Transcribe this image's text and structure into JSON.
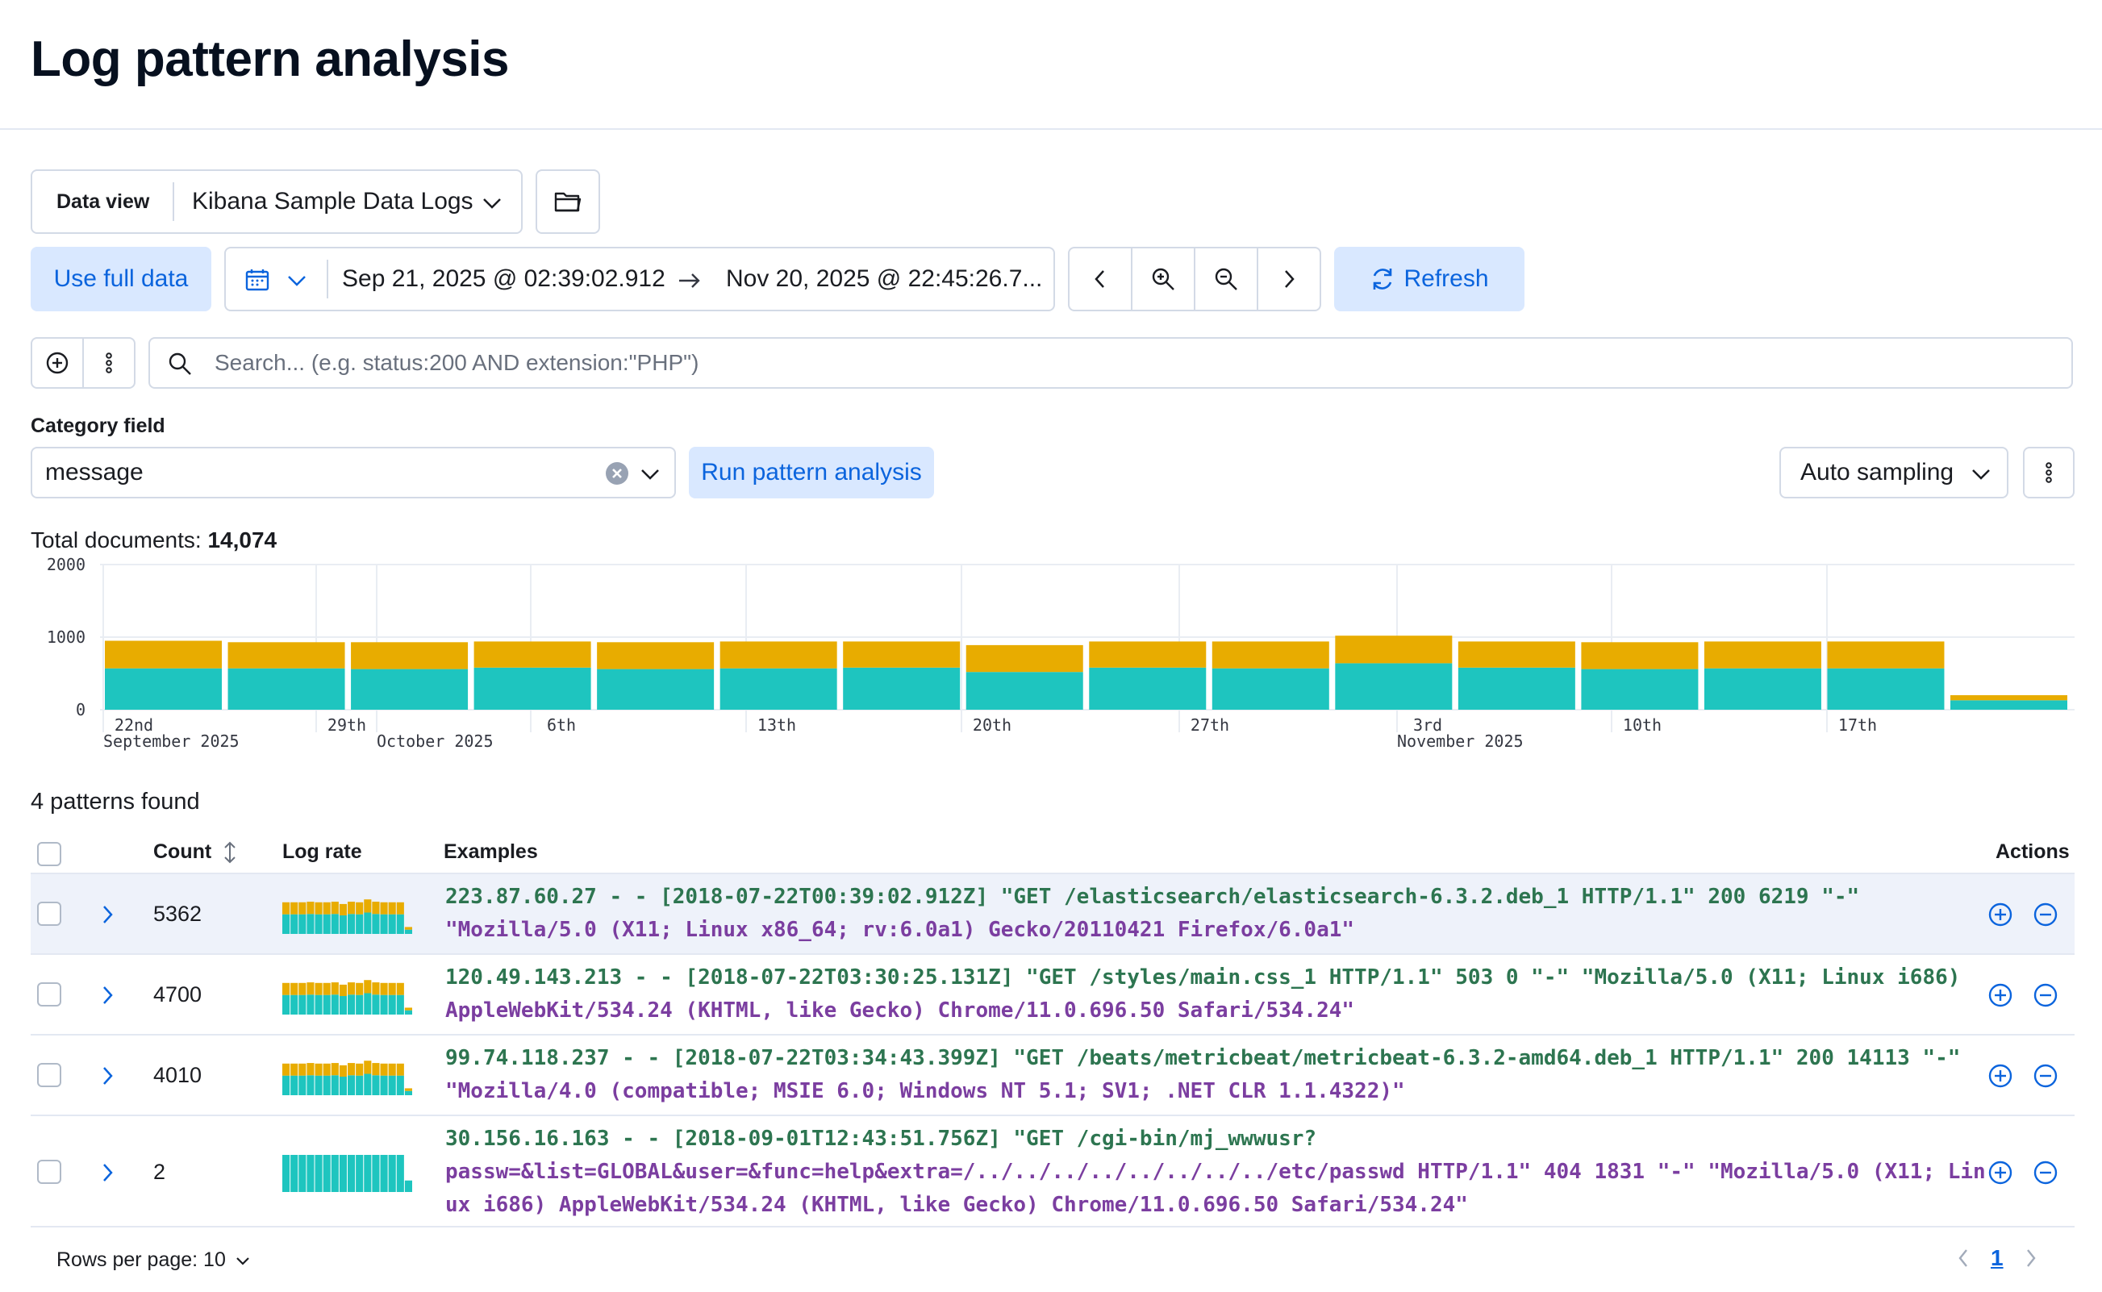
{
  "page": {
    "title": "Log pattern analysis"
  },
  "data_view": {
    "label": "Data view",
    "value": "Kibana Sample Data Logs"
  },
  "time": {
    "use_full_data": "Use full data",
    "start": "Sep 21, 2025 @ 02:39:02.912",
    "end": "Nov 20, 2025 @ 22:45:26.7...",
    "refresh": "Refresh"
  },
  "search": {
    "placeholder": "Search... (e.g. status:200 AND extension:\"PHP\")"
  },
  "category": {
    "label": "Category field",
    "value": "message",
    "run_button": "Run pattern analysis",
    "sampling": "Auto sampling"
  },
  "totals": {
    "label": "Total documents:",
    "value": "14,074"
  },
  "colors": {
    "teal": "#1ec5bf",
    "gold": "#e8ac00",
    "accent": "#0b64dd",
    "light_button": "#d9e8ff"
  },
  "chart_data": {
    "type": "bar",
    "stacked": true,
    "ylim": [
      0,
      2000
    ],
    "yticks": [
      "0",
      "1000",
      "2000"
    ],
    "xticks": [
      {
        "label": "22nd",
        "sublabel": "September 2025"
      },
      {
        "label": "29th",
        "sublabel": ""
      },
      {
        "label": "",
        "sublabel": "October 2025"
      },
      {
        "label": "6th",
        "sublabel": ""
      },
      {
        "label": "13th",
        "sublabel": ""
      },
      {
        "label": "20th",
        "sublabel": ""
      },
      {
        "label": "27th",
        "sublabel": ""
      },
      {
        "label": "3rd",
        "sublabel": "November 2025"
      },
      {
        "label": "10th",
        "sublabel": ""
      },
      {
        "label": "17th",
        "sublabel": ""
      }
    ],
    "series": [
      {
        "color": "#1ec5bf",
        "values": [
          570,
          570,
          560,
          580,
          560,
          570,
          580,
          520,
          580,
          570,
          640,
          580,
          560,
          570,
          570,
          130
        ]
      },
      {
        "color": "#e8ac00",
        "values": [
          380,
          360,
          370,
          360,
          370,
          370,
          360,
          370,
          360,
          370,
          380,
          360,
          370,
          370,
          370,
          70
        ]
      }
    ],
    "grid": true
  },
  "patterns": {
    "found_text": "4 patterns found",
    "headers": {
      "count": "Count",
      "log_rate": "Log rate",
      "examples": "Examples",
      "actions": "Actions"
    },
    "rows": [
      {
        "count": "5362",
        "example_ip": "223.87.60.27 - - [2018-07-22T00:39:02.912Z] \"GET /elasticsearch/elasticsearch-6.3.2.deb_1 HTTP/1.1\" 200 6219 \"-\"",
        "example_tail": "\"Mozilla/5.0 (X11; Linux x86_64; rv:6.0a1) Gecko/20110421 Firefox/6.0a1\"",
        "spark": [
          0.55,
          0.55,
          0.55,
          0.56,
          0.55,
          0.55,
          0.56,
          0.52,
          0.56,
          0.55,
          0.6,
          0.56,
          0.55,
          0.55,
          0.55,
          0.12
        ]
      },
      {
        "count": "4700",
        "example_ip": "120.49.143.213 - - [2018-07-22T03:30:25.131Z] \"GET /styles/main.css_1 HTTP/1.1\" 503 0 \"-\" \"Mozilla/5.0 (X11; Linux i686)",
        "example_tail": "AppleWebKit/534.24 (KHTML, like Gecko) Chrome/11.0.696.50 Safari/534.24\"",
        "spark": [
          0.55,
          0.55,
          0.55,
          0.56,
          0.55,
          0.55,
          0.56,
          0.52,
          0.56,
          0.55,
          0.6,
          0.56,
          0.55,
          0.55,
          0.55,
          0.12
        ]
      },
      {
        "count": "4010",
        "example_ip": "99.74.118.237 - - [2018-07-22T03:34:43.399Z] \"GET /beats/metricbeat/metricbeat-6.3.2-amd64.deb_1 HTTP/1.1\" 200 14113 \"-\"",
        "example_tail": "\"Mozilla/4.0 (compatible; MSIE 6.0; Windows NT 5.1; SV1; .NET CLR 1.1.4322)\"",
        "spark": [
          0.55,
          0.55,
          0.55,
          0.56,
          0.55,
          0.55,
          0.56,
          0.52,
          0.56,
          0.55,
          0.6,
          0.56,
          0.55,
          0.55,
          0.55,
          0.12
        ]
      },
      {
        "count": "2",
        "example_ip": "30.156.16.163 - - [2018-09-01T12:43:51.756Z] \"GET /cgi-bin/mj_wwwusr?",
        "example_tail": "passw=&list=GLOBAL&user=&func=help&extra=/../../../../../../../../etc/passwd HTTP/1.1\" 404 1831 \"-\" \"Mozilla/5.0 (X11; Linux i686) AppleWebKit/534.24 (KHTML, like Gecko) Chrome/11.0.696.50 Safari/534.24\"",
        "spark": [
          0.9,
          0.9,
          0.9,
          0.9,
          0.9,
          0.9,
          0.9,
          0.9,
          0.9,
          0.9,
          0.98,
          0.9,
          0.9,
          0.9,
          0.9,
          0.2
        ]
      }
    ]
  },
  "footer": {
    "rows_per_page": "Rows per page: 10",
    "current_page": "1"
  }
}
